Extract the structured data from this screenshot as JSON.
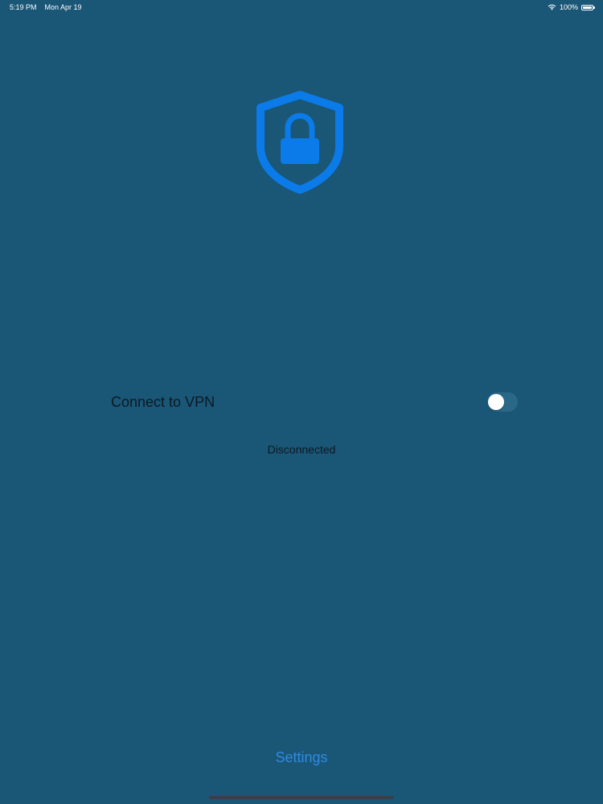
{
  "status_bar": {
    "time": "5:19 PM",
    "date": "Mon Apr 19",
    "battery_text": "100%",
    "wifi_icon": "wifi-icon",
    "battery_icon": "battery-icon"
  },
  "hero": {
    "icon": "shield-lock-icon",
    "color": "#0a7be8"
  },
  "vpn": {
    "label": "Connect to VPN",
    "toggle_on": false,
    "status": "Disconnected"
  },
  "footer": {
    "settings_label": "Settings"
  },
  "colors": {
    "background": "#1a5676",
    "accent": "#2f8be0"
  }
}
